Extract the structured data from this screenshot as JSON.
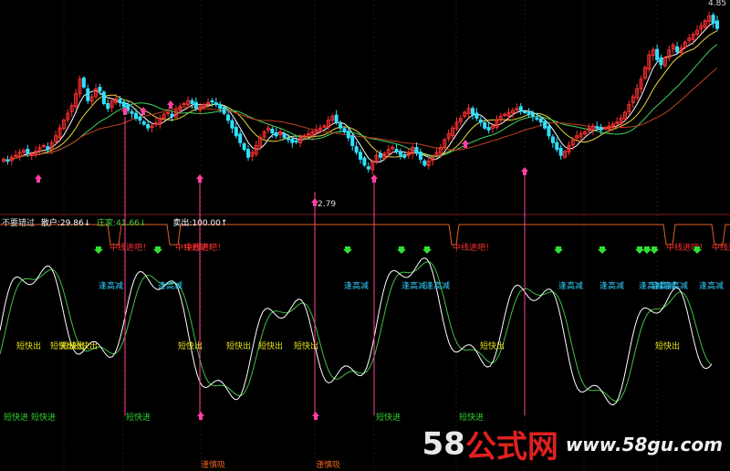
{
  "header": {
    "indicator_name": "不要错过",
    "buy_label": "散户:29.86↓",
    "main_label": "庄家:41.66↓",
    "sell_label": "卖出:100.00↑"
  },
  "annotations": {
    "high_price": "4.85",
    "low_price": "2.79",
    "tag_midline": "中线进吧！",
    "tag_reduce": "逢高减",
    "tag_short_out": "短快出",
    "tag_short_in": "短快进",
    "tag_absorb": "谨慎吸"
  },
  "watermark": {
    "digits": "58",
    "brand": "公式网",
    "url": "www.58gu.com"
  },
  "colors": {
    "up": "#ff3030",
    "down": "#30e0ff",
    "ma_white": "#ffffff",
    "ma_yellow": "#e8d840",
    "ma_green": "#40d060",
    "ma_red": "#c04020",
    "osc_white": "#ffffff",
    "osc_green": "#40c040",
    "signal_line": "#ff40a0",
    "label_yellow": "#e8e020",
    "label_cyan": "#30d0ff",
    "label_green": "#30d030",
    "label_red": "#ff3030",
    "label_orange": "#e06020"
  },
  "chart_data": {
    "type": "candlestick+indicator",
    "price_extremes": {
      "high": 4.85,
      "low": 2.79
    },
    "close": [
      3.38,
      3.36,
      3.4,
      3.42,
      3.45,
      3.47,
      3.44,
      3.43,
      3.46,
      3.5,
      3.52,
      3.48,
      3.55,
      3.62,
      3.7,
      3.78,
      3.85,
      3.93,
      4.05,
      4.2,
      4.12,
      3.98,
      4.02,
      4.1,
      4.08,
      3.95,
      3.9,
      3.98,
      4.0,
      3.96,
      3.92,
      3.88,
      3.85,
      3.8,
      3.78,
      3.74,
      3.7,
      3.72,
      3.75,
      3.8,
      3.84,
      3.86,
      3.82,
      3.88,
      3.92,
      3.95,
      3.98,
      3.95,
      3.9,
      3.92,
      3.94,
      3.96,
      3.97,
      3.94,
      3.9,
      3.85,
      3.78,
      3.7,
      3.62,
      3.55,
      3.48,
      3.4,
      3.45,
      3.52,
      3.6,
      3.66,
      3.7,
      3.65,
      3.62,
      3.66,
      3.6,
      3.58,
      3.55,
      3.56,
      3.6,
      3.62,
      3.64,
      3.66,
      3.68,
      3.7,
      3.72,
      3.78,
      3.82,
      3.76,
      3.7,
      3.66,
      3.6,
      3.52,
      3.45,
      3.38,
      3.32,
      3.28,
      3.35,
      3.42,
      3.4,
      3.44,
      3.48,
      3.5,
      3.46,
      3.42,
      3.4,
      3.45,
      3.5,
      3.44,
      3.38,
      3.32,
      3.36,
      3.4,
      3.45,
      3.5,
      3.58,
      3.64,
      3.7,
      3.76,
      3.8,
      3.86,
      3.9,
      3.84,
      3.8,
      3.76,
      3.7,
      3.68,
      3.72,
      3.78,
      3.82,
      3.84,
      3.86,
      3.88,
      3.9,
      3.88,
      3.86,
      3.84,
      3.82,
      3.8,
      3.76,
      3.7,
      3.62,
      3.55,
      3.48,
      3.42,
      3.46,
      3.52,
      3.58,
      3.62,
      3.64,
      3.66,
      3.7,
      3.72,
      3.7,
      3.68,
      3.7,
      3.72,
      3.74,
      3.76,
      3.8,
      3.86,
      3.94,
      4.02,
      4.1,
      4.2,
      4.32,
      4.45,
      4.5,
      4.4,
      4.35,
      4.42,
      4.5,
      4.55,
      4.48,
      4.52,
      4.58,
      4.62,
      4.66,
      4.7,
      4.75,
      4.8,
      4.85,
      4.78,
      4.72
    ]
  }
}
